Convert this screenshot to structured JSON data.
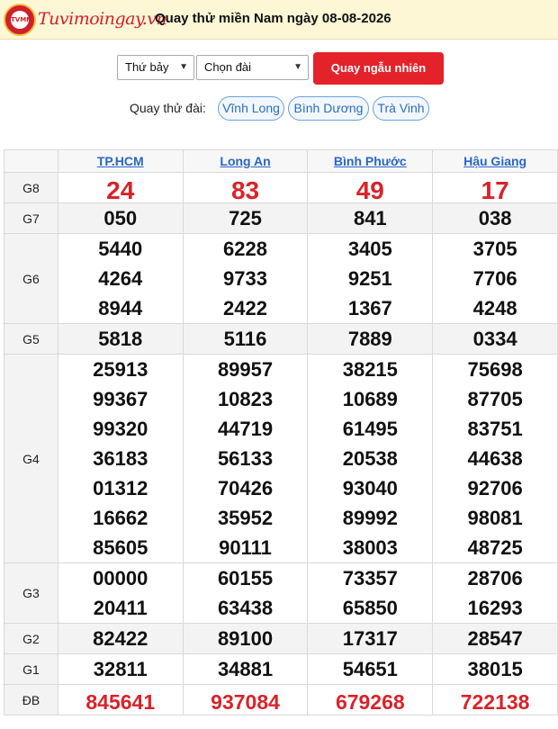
{
  "header": {
    "logo_text": "Tuvimoingay.vn",
    "logo_badge": "TVMN",
    "title": "Quay thử miền Nam ngày 08-08-2026"
  },
  "controls": {
    "day_select": "Thứ bảy",
    "station_select": "Chọn đài",
    "random_button": "Quay ngẫu nhiên"
  },
  "stations_row": {
    "label": "Quay thử đài:",
    "chips": [
      "Vĩnh Long",
      "Bình Dương",
      "Trà Vinh"
    ]
  },
  "table": {
    "columns": [
      "TP.HCM",
      "Long An",
      "Bình Phước",
      "Hậu Giang"
    ],
    "rows": [
      {
        "label": "G8",
        "cells": [
          [
            "24"
          ],
          [
            "83"
          ],
          [
            "49"
          ],
          [
            "17"
          ]
        ]
      },
      {
        "label": "G7",
        "cells": [
          [
            "050"
          ],
          [
            "725"
          ],
          [
            "841"
          ],
          [
            "038"
          ]
        ]
      },
      {
        "label": "G6",
        "cells": [
          [
            "5440",
            "4264",
            "8944"
          ],
          [
            "6228",
            "9733",
            "2422"
          ],
          [
            "3405",
            "9251",
            "1367"
          ],
          [
            "3705",
            "7706",
            "4248"
          ]
        ]
      },
      {
        "label": "G5",
        "cells": [
          [
            "5818"
          ],
          [
            "5116"
          ],
          [
            "7889"
          ],
          [
            "0334"
          ]
        ]
      },
      {
        "label": "G4",
        "cells": [
          [
            "25913",
            "99367",
            "99320",
            "36183",
            "01312",
            "16662",
            "85605"
          ],
          [
            "89957",
            "10823",
            "44719",
            "56133",
            "70426",
            "35952",
            "90111"
          ],
          [
            "38215",
            "10689",
            "61495",
            "20538",
            "93040",
            "89992",
            "38003"
          ],
          [
            "75698",
            "87705",
            "83751",
            "44638",
            "92706",
            "98081",
            "48725"
          ]
        ]
      },
      {
        "label": "G3",
        "cells": [
          [
            "00000",
            "20411"
          ],
          [
            "60155",
            "63438"
          ],
          [
            "73357",
            "65850"
          ],
          [
            "28706",
            "16293"
          ]
        ]
      },
      {
        "label": "G2",
        "cells": [
          [
            "82422"
          ],
          [
            "89100"
          ],
          [
            "17317"
          ],
          [
            "28547"
          ]
        ]
      },
      {
        "label": "G1",
        "cells": [
          [
            "32811"
          ],
          [
            "34881"
          ],
          [
            "54651"
          ],
          [
            "38015"
          ]
        ]
      },
      {
        "label": "ĐB",
        "cells": [
          [
            "845641"
          ],
          [
            "937084"
          ],
          [
            "679268"
          ],
          [
            "722138"
          ]
        ]
      }
    ]
  },
  "colors": {
    "accent_red": "#d8232a",
    "link_blue": "#2a66c4",
    "header_bg": "#fdf7d6"
  }
}
